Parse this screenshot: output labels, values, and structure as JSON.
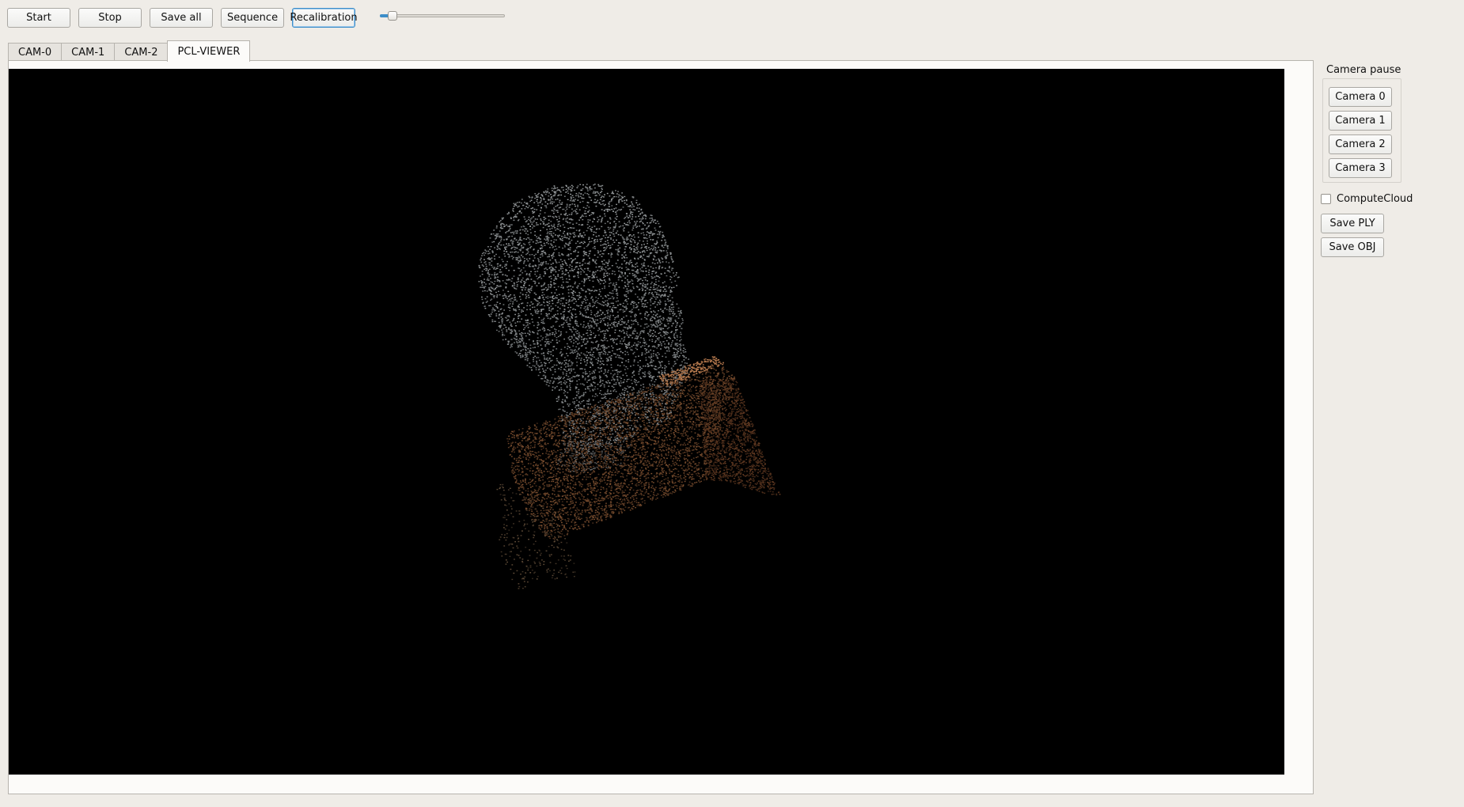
{
  "toolbar": {
    "start_label": "Start",
    "stop_label": "Stop",
    "save_all_label": "Save all",
    "sequence_label": "Sequence",
    "recalibration_label": "Recalibration",
    "slider_value_fraction": 0.1
  },
  "tabs": [
    {
      "label": "CAM-0",
      "active": false
    },
    {
      "label": "CAM-1",
      "active": false
    },
    {
      "label": "CAM-2",
      "active": false
    },
    {
      "label": "PCL-VIEWER",
      "active": true
    }
  ],
  "sidebar": {
    "camera_pause_title": "Camera pause",
    "camera_buttons": [
      "Camera 0",
      "Camera 1",
      "Camera 2",
      "Camera 3"
    ],
    "compute_cloud_label": "ComputeCloud",
    "compute_cloud_checked": false,
    "save_ply_label": "Save PLY",
    "save_obj_label": "Save OBJ"
  },
  "colors": {
    "window_bg": "#efece7",
    "viewer_bg": "#000000",
    "accent": "#3d8ec9",
    "head_points": "#6e7376",
    "box_points": "#6b4326"
  }
}
